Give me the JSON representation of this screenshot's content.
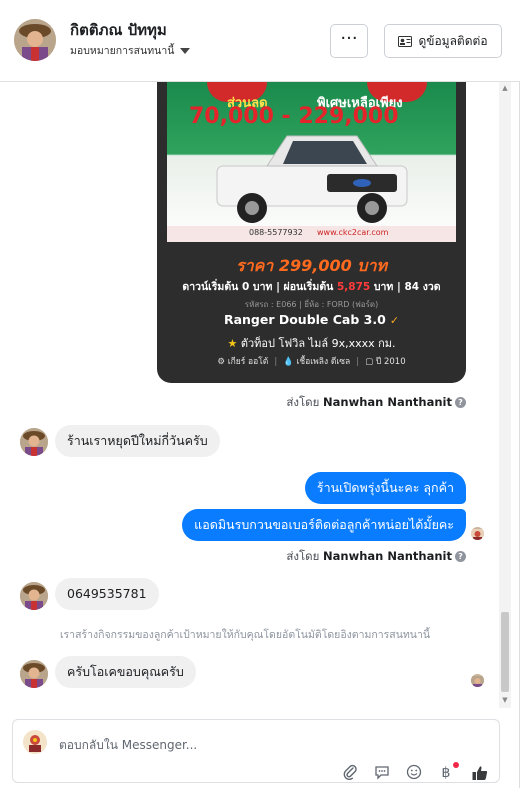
{
  "header": {
    "name": "กิตติภณ ปัททุม",
    "subtitle": "มอบหมายการสนทนานี้",
    "contact_button": "ดูข้อมูลติดต่อ",
    "more_button": "···"
  },
  "ad": {
    "sale_label": "ส่วนลด",
    "special_label": "พิเศษเหลือเพียง",
    "sale_amount": "70,000 - 229,000",
    "phone": "088-5577932",
    "website": "www.ckc2car.com",
    "price": "ราคา 299,000 บาท",
    "down_prefix": "ดาวน์เริ่มต้น 0 บาท | ผ่อนเริ่มต้น",
    "down_amount": "5,875",
    "down_suffix": "บาท | 84 งวด",
    "code_line": "รหัสรถ : E066 | ยี่ห้อ : FORD (ฟอร์ด)",
    "model": "Ranger Double Cab 3.0",
    "top_line": "ตัวท็อป โฟวิล ไมล์ 9x,xxxx กม.",
    "spec_gear": "เกียร์ ออโต้",
    "spec_fuel": "เชื้อเพลิง ดีเซล",
    "spec_year": "ปี 2010"
  },
  "messages": {
    "sent_by_prefix": "ส่งโดย",
    "sender": "Nanwhan Nanthanit",
    "m1": "ร้านเราหยุดปีใหม่กี่วันครับ",
    "m2": "ร้านเปิดพรุ่งนี้นะคะ ลุกค้า",
    "m3": "แอดมินรบกวนขอเบอร์ติดต่อลูกค้าหน่อยได้มั้ยคะ",
    "m4": "0649535781",
    "system_note": "เราสร้างกิจกรรมของลูกค้าเป้าหมายให้กับคุณโดยอัตโนมัติโดยอิงตามการสนทนานี้",
    "m5": "ครับโอเคขอบคุณครับ"
  },
  "composer": {
    "placeholder": "ตอบกลับใน Messenger..."
  },
  "icons": {
    "attach": "paperclip-icon",
    "quick_reply": "chat-bubble-icon",
    "emoji": "smiley-icon",
    "currency": "baht-icon",
    "like": "thumbs-up-icon"
  },
  "colors": {
    "outgoing_bubble": "#0a7cff",
    "incoming_bubble": "#f0f0f0",
    "ad_background": "#2d2d2d",
    "ad_price": "#ff6a1f"
  }
}
